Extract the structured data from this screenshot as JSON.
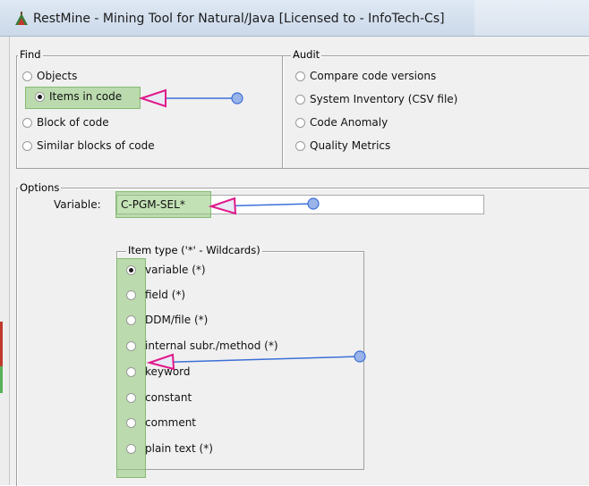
{
  "window": {
    "title": "RestMine - Mining Tool for Natural/Java [Licensed to  - InfoTech-Cs]"
  },
  "find": {
    "label": "Find",
    "options": [
      {
        "label": "Objects",
        "selected": false
      },
      {
        "label": "Items in code",
        "selected": true
      },
      {
        "label": "Block of code",
        "selected": false
      },
      {
        "label": "Similar blocks of code",
        "selected": false
      }
    ]
  },
  "audit": {
    "label": "Audit",
    "options": [
      {
        "label": "Compare code versions",
        "selected": false
      },
      {
        "label": "System Inventory (CSV file)",
        "selected": false
      },
      {
        "label": "Code Anomaly",
        "selected": false
      },
      {
        "label": "Quality Metrics",
        "selected": false
      }
    ]
  },
  "options": {
    "label": "Options",
    "variable_label": "Variable:",
    "variable_value": "C-PGM-SEL*"
  },
  "item_type": {
    "label": "Item type ('*' - Wildcards)",
    "options": [
      {
        "label": "variable (*)",
        "selected": true
      },
      {
        "label": "field (*)",
        "selected": false
      },
      {
        "label": "DDM/file (*)",
        "selected": false
      },
      {
        "label": "internal subr./method (*)",
        "selected": false
      },
      {
        "label": "keyword",
        "selected": false
      },
      {
        "label": "constant",
        "selected": false
      },
      {
        "label": "comment",
        "selected": false
      },
      {
        "label": "plain text (*)",
        "selected": false
      }
    ]
  },
  "annotation": {
    "highlight_color": "#90c878",
    "arrow_color": "#3b6fd8"
  }
}
